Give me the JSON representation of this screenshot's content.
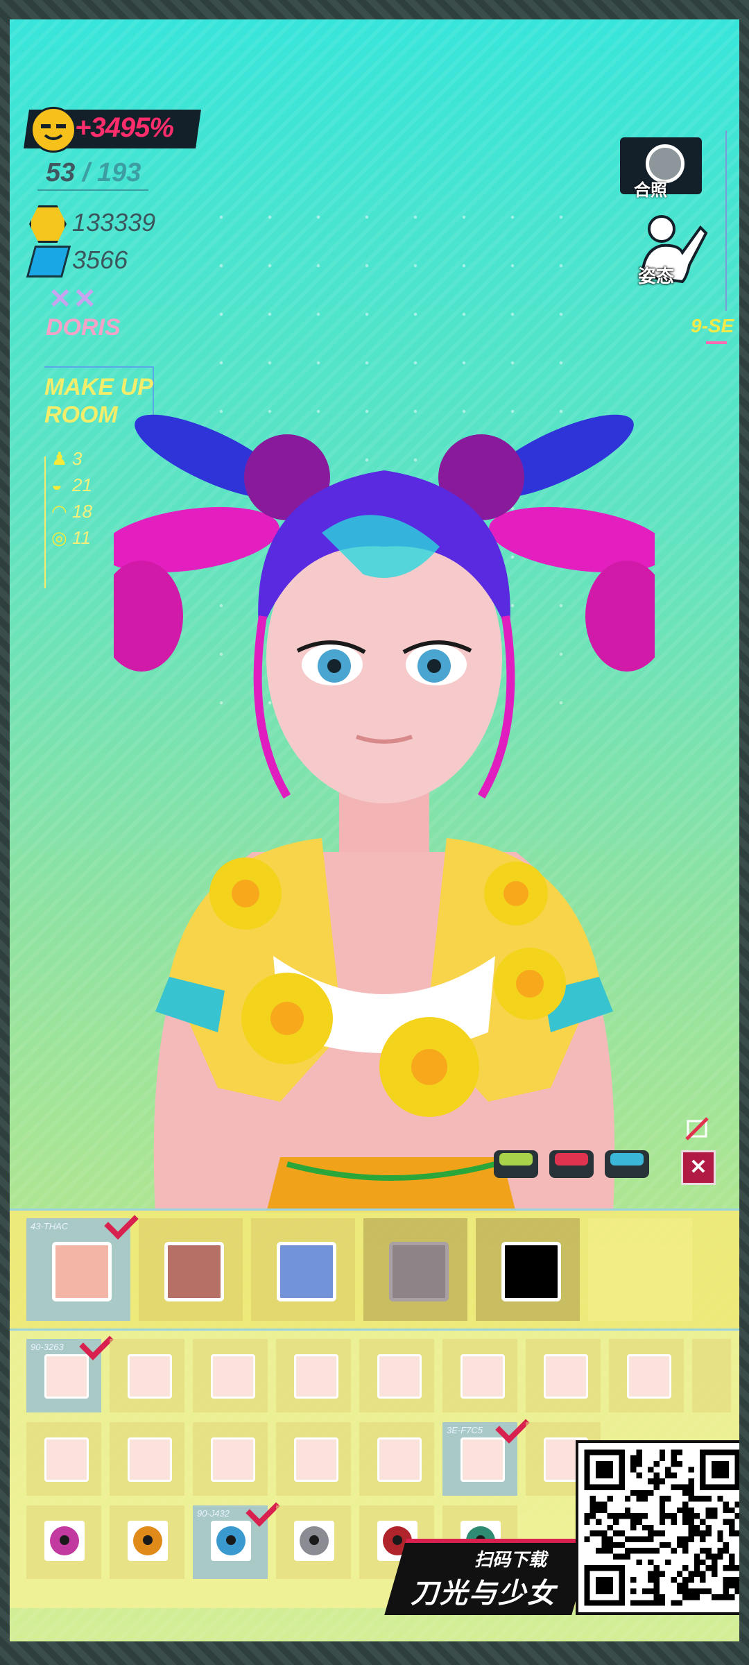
{
  "hud": {
    "bonus_percent": "+3495%",
    "level_current": "53",
    "level_separator": " / ",
    "level_max": "193",
    "gold": "133339",
    "gems": "3566",
    "marks": "✕✕",
    "player_name": "DORIS",
    "room_line1": "MAKE UP",
    "room_line2": "ROOM",
    "stats": [
      {
        "icon": "person-icon",
        "value": "3"
      },
      {
        "icon": "lips-icon",
        "value": "21"
      },
      {
        "icon": "brow-icon",
        "value": "18"
      },
      {
        "icon": "eye-icon",
        "value": "11"
      }
    ],
    "photo_label": "合照",
    "pose_label": "姿态",
    "zone_code": "9-SE"
  },
  "colors": {
    "accent_red": "#d8214e",
    "btn_green": "#a8d24a",
    "btn_red": "#e0334f",
    "btn_blue": "#39b6d8"
  },
  "skin_panel": {
    "selected_tag": "43-THAC",
    "swatches": [
      "#f3b5a6",
      "#b77066",
      "#7393d9",
      "#8e8487",
      "#000000"
    ]
  },
  "mouth_row": {
    "selected_tag": "90-3263"
  },
  "eyeline_row": {
    "selected_tag": "3E-F7C5"
  },
  "eye_row": {
    "selected_tag": "90-J432",
    "iris_colors": [
      "#c23aa0",
      "#e08a1a",
      "#3a9ad0",
      "#8b8b93",
      "#b0242c",
      "#2e8a72",
      "#444"
    ]
  },
  "promo": {
    "scan_text": "扫码下载",
    "game_title": "刀光与少女"
  }
}
